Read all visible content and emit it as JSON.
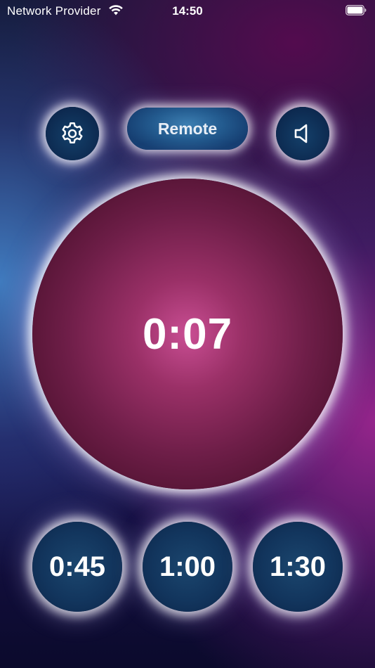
{
  "status_bar": {
    "carrier": "Network Provider",
    "time": "14:50",
    "icons": [
      "wifi-icon",
      "battery-icon"
    ]
  },
  "controls": {
    "settings_icon": "gear-icon",
    "remote_label": "Remote",
    "sound_icon": "speaker-icon"
  },
  "timer": {
    "display": "0:07"
  },
  "presets": [
    {
      "label": "0:45"
    },
    {
      "label": "1:00"
    },
    {
      "label": "1:30"
    }
  ],
  "colors": {
    "button_fill": "#12355d",
    "timer_center": "#c94e93",
    "timer_edge": "#3e0c25",
    "glow": "#ffffff"
  }
}
